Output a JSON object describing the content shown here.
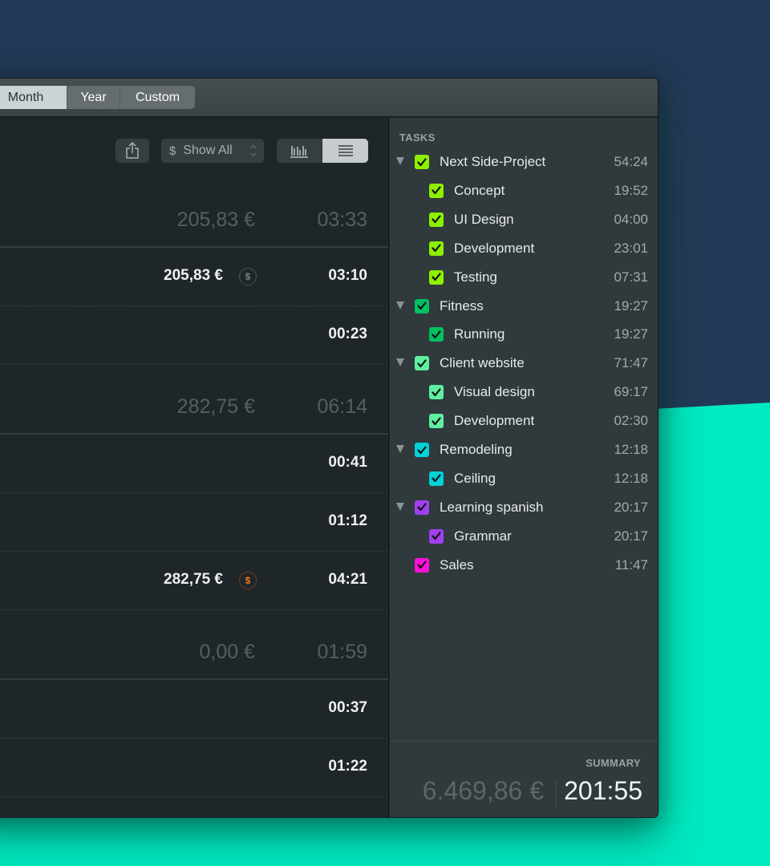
{
  "toolbar": {
    "range_tabs": [
      {
        "label": "Month",
        "selected": true
      },
      {
        "label": "Year",
        "selected": false
      },
      {
        "label": "Custom",
        "selected": false
      }
    ]
  },
  "controls": {
    "share_icon": "share-icon",
    "filter": {
      "currency_symbol": "$",
      "label": "Show All",
      "icon": "updown-chevron-icon"
    },
    "view_toggle": [
      {
        "icon": "bar-chart-icon",
        "selected": false
      },
      {
        "icon": "list-icon",
        "selected": true
      }
    ]
  },
  "groups": [
    {
      "amount": "205,83 €",
      "time": "03:33",
      "entries": [
        {
          "amount": "205,83 €",
          "billing_icon": "dollar-coin-icon",
          "billing_color": "#7c8386",
          "time": "03:10"
        },
        {
          "amount": "",
          "time": "00:23"
        }
      ]
    },
    {
      "amount": "282,75 €",
      "time": "06:14",
      "entries": [
        {
          "amount": "",
          "time": "00:41"
        },
        {
          "amount": "",
          "time": "01:12"
        },
        {
          "amount": "282,75 €",
          "billing_icon": "dollar-coin-icon",
          "billing_color": "#f07a1a",
          "time": "04:21"
        }
      ]
    },
    {
      "amount": "0,00 €",
      "time": "01:59",
      "entries": [
        {
          "amount": "",
          "time": "00:37"
        },
        {
          "amount": "",
          "time": "01:22"
        }
      ]
    }
  ],
  "sidebar": {
    "tasks_label": "TASKS",
    "tasks": [
      {
        "name": "Next Side-Project",
        "duration": "54:24",
        "level": 0,
        "expanded": true,
        "checked": true,
        "color": "#8cf000"
      },
      {
        "name": "Concept",
        "duration": "19:52",
        "level": 1,
        "checked": true,
        "color": "#8cf000"
      },
      {
        "name": "UI Design",
        "duration": "04:00",
        "level": 1,
        "checked": true,
        "color": "#8cf000"
      },
      {
        "name": "Development",
        "duration": "23:01",
        "level": 1,
        "checked": true,
        "color": "#8cf000"
      },
      {
        "name": "Testing",
        "duration": "07:31",
        "level": 1,
        "checked": true,
        "color": "#8cf000"
      },
      {
        "name": "Fitness",
        "duration": "19:27",
        "level": 0,
        "expanded": true,
        "checked": true,
        "color": "#00c060"
      },
      {
        "name": "Running",
        "duration": "19:27",
        "level": 1,
        "checked": true,
        "color": "#00c060"
      },
      {
        "name": "Client website",
        "duration": "71:47",
        "level": 0,
        "expanded": true,
        "checked": true,
        "color": "#5ef0a0"
      },
      {
        "name": "Visual design",
        "duration": "69:17",
        "level": 1,
        "checked": true,
        "color": "#5ef0a0"
      },
      {
        "name": "Development",
        "duration": "02:30",
        "level": 1,
        "checked": true,
        "color": "#5ef0a0"
      },
      {
        "name": "Remodeling",
        "duration": "12:18",
        "level": 0,
        "expanded": true,
        "checked": true,
        "color": "#00d2d6"
      },
      {
        "name": "Ceiling",
        "duration": "12:18",
        "level": 1,
        "checked": true,
        "color": "#00d2d6"
      },
      {
        "name": "Learning spanish",
        "duration": "20:17",
        "level": 0,
        "expanded": true,
        "checked": true,
        "color": "#a040f0"
      },
      {
        "name": "Grammar",
        "duration": "20:17",
        "level": 1,
        "checked": true,
        "color": "#a040f0"
      },
      {
        "name": "Sales",
        "duration": "11:47",
        "level": 0,
        "expanded": false,
        "checked": true,
        "color": "#ff10d8"
      }
    ],
    "summary": {
      "label": "SUMMARY",
      "amount": "6.469,86 €",
      "time": "201:55"
    }
  }
}
